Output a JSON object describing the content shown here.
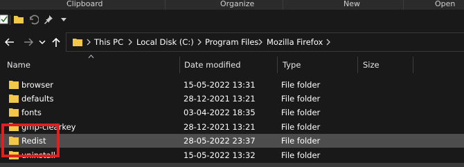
{
  "ribbon": {
    "groups": [
      "Clipboard",
      "Organize",
      "New",
      "Open"
    ]
  },
  "quick_access": {
    "icons": [
      "properties-icon",
      "new-folder-icon",
      "undo-icon",
      "pin-icon",
      "customize-dropdown-icon"
    ]
  },
  "navigation": {
    "icons": [
      "back-arrow-icon",
      "forward-arrow-icon",
      "recent-locations-icon",
      "up-arrow-icon"
    ]
  },
  "address_bar": {
    "crumbs": [
      "This PC",
      "Local Disk (C:)",
      "Program Files",
      "Mozilla Firefox"
    ]
  },
  "columns": {
    "name": "Name",
    "date_modified": "Date modified",
    "type": "Type",
    "size": "Size"
  },
  "files": [
    {
      "name": "browser",
      "date": "15-05-2022 13:31",
      "type": "File folder"
    },
    {
      "name": "defaults",
      "date": "28-12-2021 13:21",
      "type": "File folder"
    },
    {
      "name": "fonts",
      "date": "03-04-2022 18:35",
      "type": "File folder"
    },
    {
      "name": "gmp-clearkey",
      "date": "28-12-2021 13:21",
      "type": "File folder"
    },
    {
      "name": "Redist",
      "date": "28-05-2022 23:37",
      "type": "File folder",
      "selected": true
    },
    {
      "name": "uninstall",
      "date": "15-05-2022 13:32",
      "type": "File folder"
    }
  ],
  "colors": {
    "background": "#191919",
    "selection": "#4d4d4d",
    "folder": "#f2c84b",
    "annotation": "#e02020"
  }
}
